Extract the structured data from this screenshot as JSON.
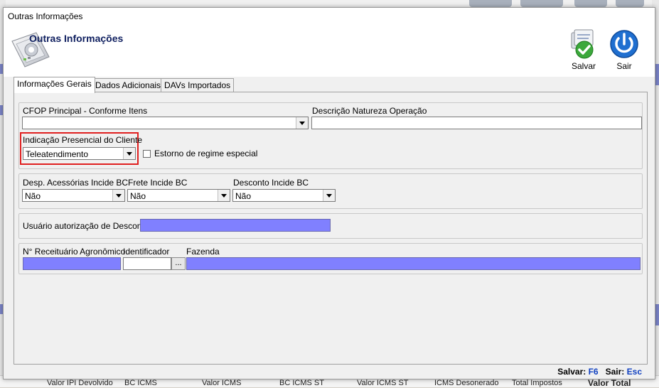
{
  "window": {
    "title": "Outras Informações"
  },
  "header": {
    "title": "Outras Informações"
  },
  "toolbar": {
    "save_label": "Salvar",
    "exit_label": "Sair"
  },
  "tabs": [
    {
      "label": "Informações Gerais",
      "active": true
    },
    {
      "label": "Dados Adicionais",
      "active": false
    },
    {
      "label": "DAVs Importados",
      "active": false
    }
  ],
  "general": {
    "cfop_label": "CFOP Principal - Conforme Itens",
    "cfop_value": "",
    "natureza_label": "Descrição Natureza Operação",
    "natureza_value": "",
    "indicacao_label": "Indicação Presencial do Cliente",
    "indicacao_value": "Teleatendimento",
    "estorno_label": "Estorno de regime especial",
    "estorno_checked": false
  },
  "bc": {
    "desp_label": "Desp. Acessórias Incide BC",
    "desp_value": "Não",
    "frete_label": "Frete Incide BC",
    "frete_value": "Não",
    "desconto_label": "Desconto Incide BC",
    "desconto_value": "Não"
  },
  "desconto": {
    "usuario_label": "Usuário autorização de Desconto:"
  },
  "agro": {
    "receituario_label": "N° Receituário Agronômico",
    "identificador_label": "Identificador",
    "fazenda_label": "Fazenda",
    "lookup_label": "..."
  },
  "footer": {
    "save_prefix": "Salvar:",
    "save_key": "F6",
    "exit_prefix": "Sair:",
    "exit_key": "Esc"
  },
  "background_columns": [
    "Valor IPI Devolvido",
    "BC ICMS",
    "Valor ICMS",
    "BC ICMS ST",
    "Valor ICMS ST",
    "ICMS Desonerado",
    "Total Impostos",
    "Valor Total"
  ],
  "colors": {
    "accent_blue": "#8080ff",
    "highlight_red": "#e02020",
    "title_navy": "#102060",
    "key_blue": "#1040c0"
  }
}
